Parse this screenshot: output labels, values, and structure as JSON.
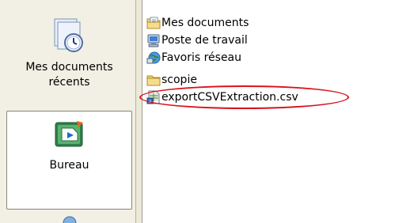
{
  "places_bar": {
    "items": [
      {
        "label": "Mes documents\nrécents",
        "icon": "recent-documents-icon"
      },
      {
        "label": "Bureau",
        "icon": "desktop-icon"
      }
    ]
  },
  "file_list": {
    "items": [
      {
        "name": "Mes documents",
        "icon": "folder-documents-icon"
      },
      {
        "name": "Poste de travail",
        "icon": "my-computer-icon"
      },
      {
        "name": "Favoris réseau",
        "icon": "network-places-icon"
      },
      {
        "name": "scopie",
        "icon": "folder-icon"
      },
      {
        "name": "exportCSVExtraction.csv",
        "icon": "csv-file-icon",
        "highlighted": true
      }
    ]
  },
  "colors": {
    "places_bar_bg": "#f2f0e4",
    "highlight_ring": "#d8131c"
  }
}
